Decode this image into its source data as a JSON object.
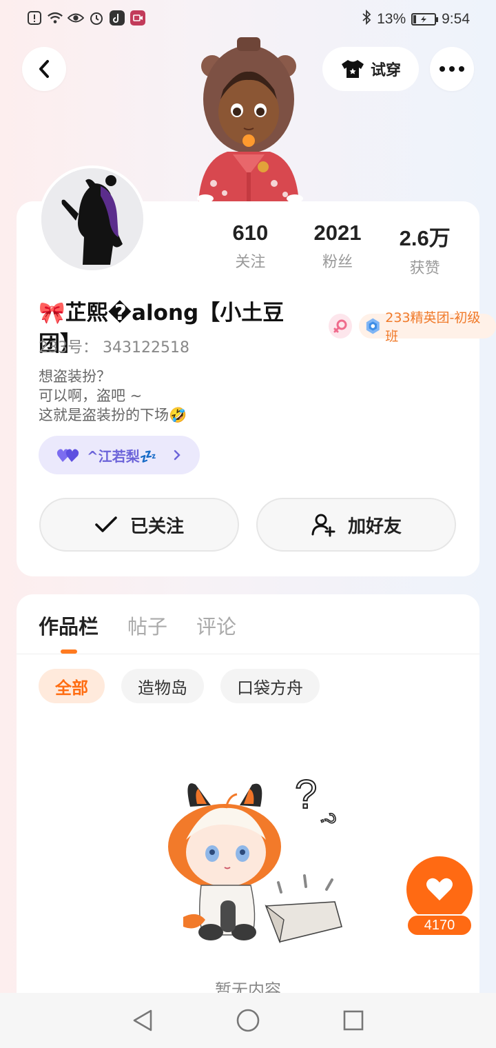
{
  "status_bar": {
    "battery_percent": "13%",
    "time": "9:54",
    "icons": [
      "alert-icon",
      "wifi-icon",
      "eye-icon",
      "alarm-icon",
      "tiktok-icon",
      "screen-record-icon",
      "bluetooth-icon",
      "battery-icon"
    ]
  },
  "header": {
    "try_on_label": "试穿"
  },
  "profile": {
    "stats": [
      {
        "value": "610",
        "label": "关注"
      },
      {
        "value": "2021",
        "label": "粉丝"
      },
      {
        "value": "2.6万",
        "label": "获赞"
      }
    ],
    "nickname": "🎀芷熙�along【小土豆团】",
    "title_badge": "233精英团-初级班",
    "uid": "233号： 343122518",
    "bio": [
      "想盗装扮？",
      "可以啊，盗吧 ~",
      "这就是盗装扮的下场🤣"
    ],
    "partner": "^江若梨💤",
    "follow_label": "已关注",
    "add_friend_label": "加好友"
  },
  "content": {
    "tabs": [
      "作品栏",
      "帖子",
      "评论"
    ],
    "active_tab": 0,
    "filters": [
      "全部",
      "造物岛",
      "口袋方舟"
    ],
    "active_filter": 0,
    "empty_text": "暂无内容"
  },
  "like": {
    "count": "4170"
  },
  "colors": {
    "accent": "#ff6a13",
    "partner_text": "#6b63d9",
    "badge_text": "#f07a2a"
  }
}
